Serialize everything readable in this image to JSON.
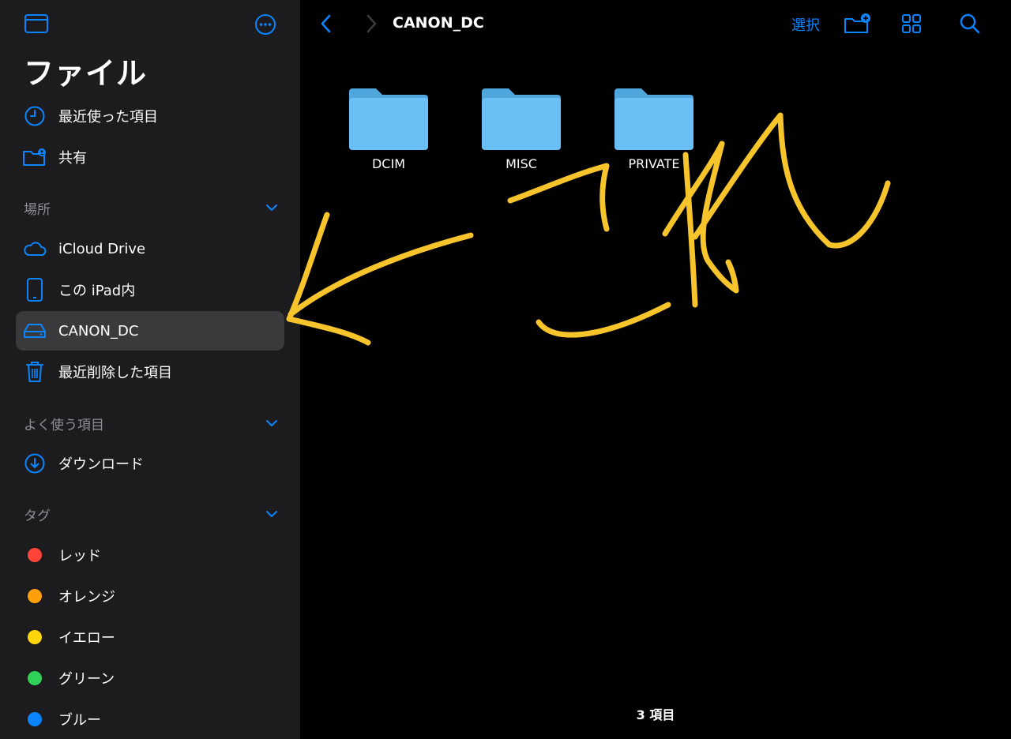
{
  "sidebar": {
    "title": "ファイル",
    "top_items": [
      {
        "label": "最近使った項目",
        "icon": "clock-icon"
      },
      {
        "label": "共有",
        "icon": "shared-folder-icon"
      }
    ],
    "sections": {
      "locations": {
        "label": "場所"
      },
      "favorites": {
        "label": "よく使う項目"
      },
      "tags": {
        "label": "タグ"
      }
    },
    "locations": [
      {
        "label": "iCloud Drive",
        "icon": "cloud-icon"
      },
      {
        "label": "この iPad内",
        "icon": "ipad-icon"
      },
      {
        "label": "CANON_DC",
        "icon": "drive-icon",
        "selected": true
      },
      {
        "label": "最近削除した項目",
        "icon": "trash-icon"
      }
    ],
    "favorites": [
      {
        "label": "ダウンロード",
        "icon": "download-icon"
      }
    ],
    "tags": [
      {
        "label": "レッド",
        "color": "#ff453a"
      },
      {
        "label": "オレンジ",
        "color": "#ff9f0a"
      },
      {
        "label": "イエロー",
        "color": "#ffd60a"
      },
      {
        "label": "グリーン",
        "color": "#30d158"
      },
      {
        "label": "ブルー",
        "color": "#0a84ff"
      }
    ]
  },
  "toolbar": {
    "title": "CANON_DC",
    "select_label": "選択"
  },
  "folders": [
    {
      "name": "DCIM"
    },
    {
      "name": "MISC"
    },
    {
      "name": "PRIVATE"
    }
  ],
  "status": {
    "item_count": "3 項目"
  },
  "colors": {
    "accent": "#0a84ff",
    "sidebar_bg": "#1c1c1e",
    "selected_bg": "#3a3a3c",
    "folder": "#5ab5f0",
    "annotation": "#f7c42b"
  }
}
